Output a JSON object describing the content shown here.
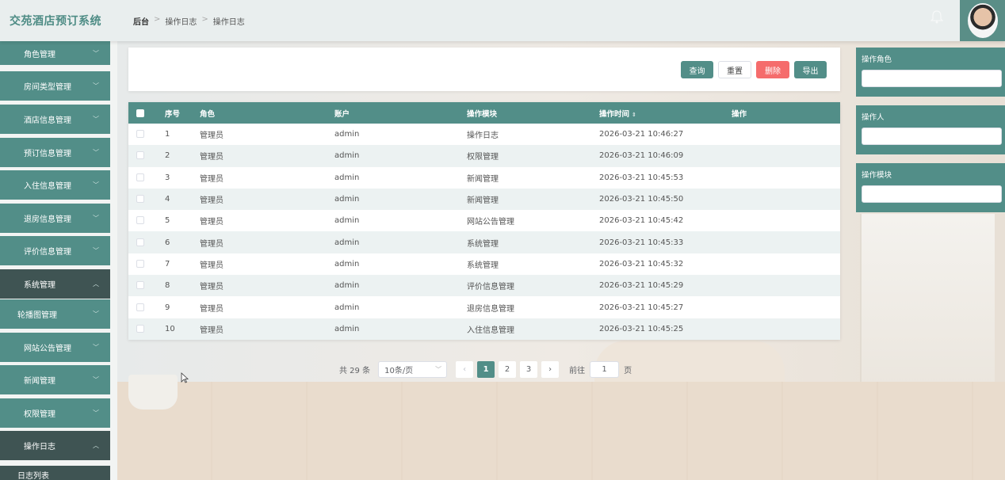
{
  "header": {
    "logo": "交苑酒店预订系统",
    "breadcrumb": [
      "后台",
      "操作日志",
      "操作日志"
    ]
  },
  "sidebar": {
    "items": [
      {
        "label": "角色管理",
        "state": "collapsed"
      },
      {
        "label": "房间类型管理",
        "state": "collapsed"
      },
      {
        "label": "酒店信息管理",
        "state": "collapsed"
      },
      {
        "label": "预订信息管理",
        "state": "collapsed"
      },
      {
        "label": "入住信息管理",
        "state": "collapsed"
      },
      {
        "label": "退房信息管理",
        "state": "collapsed"
      },
      {
        "label": "评价信息管理",
        "state": "collapsed"
      },
      {
        "label": "系统管理",
        "state": "expanded"
      },
      {
        "label": "轮播图管理",
        "state": "collapsed"
      },
      {
        "label": "网站公告管理",
        "state": "collapsed"
      },
      {
        "label": "新闻管理",
        "state": "collapsed"
      },
      {
        "label": "权限管理",
        "state": "collapsed"
      },
      {
        "label": "操作日志",
        "state": "expanded"
      },
      {
        "label": "日志列表",
        "state": "sub"
      }
    ]
  },
  "toolbar": {
    "query": "查询",
    "reset": "重置",
    "delete": "删除",
    "export": "导出"
  },
  "table": {
    "headers": [
      "序号",
      "角色",
      "账户",
      "操作模块",
      "操作时间",
      "操作"
    ],
    "rows": [
      {
        "no": "1",
        "role": "管理员",
        "account": "admin",
        "module": "操作日志",
        "time": "2026-03-21 10:46:27"
      },
      {
        "no": "2",
        "role": "管理员",
        "account": "admin",
        "module": "权限管理",
        "time": "2026-03-21 10:46:09"
      },
      {
        "no": "3",
        "role": "管理员",
        "account": "admin",
        "module": "新闻管理",
        "time": "2026-03-21 10:45:53"
      },
      {
        "no": "4",
        "role": "管理员",
        "account": "admin",
        "module": "新闻管理",
        "time": "2026-03-21 10:45:50"
      },
      {
        "no": "5",
        "role": "管理员",
        "account": "admin",
        "module": "网站公告管理",
        "time": "2026-03-21 10:45:42"
      },
      {
        "no": "6",
        "role": "管理员",
        "account": "admin",
        "module": "系统管理",
        "time": "2026-03-21 10:45:33"
      },
      {
        "no": "7",
        "role": "管理员",
        "account": "admin",
        "module": "系统管理",
        "time": "2026-03-21 10:45:32"
      },
      {
        "no": "8",
        "role": "管理员",
        "account": "admin",
        "module": "评价信息管理",
        "time": "2026-03-21 10:45:29"
      },
      {
        "no": "9",
        "role": "管理员",
        "account": "admin",
        "module": "退房信息管理",
        "time": "2026-03-21 10:45:27"
      },
      {
        "no": "10",
        "role": "管理员",
        "account": "admin",
        "module": "入住信息管理",
        "time": "2026-03-21 10:45:25"
      }
    ]
  },
  "pagination": {
    "total": "共 29 条",
    "page_size": "10条/页",
    "pages": [
      "1",
      "2",
      "3"
    ],
    "current": "1",
    "goto_label": "前往",
    "goto_value": "1",
    "goto_suffix": "页"
  },
  "filters": {
    "role_label": "操作角色",
    "user_label": "操作人",
    "module_label": "操作模块"
  },
  "colors": {
    "accent": "#528e88",
    "danger": "#f56c6c",
    "sidebar_dark": "#3f5453"
  }
}
